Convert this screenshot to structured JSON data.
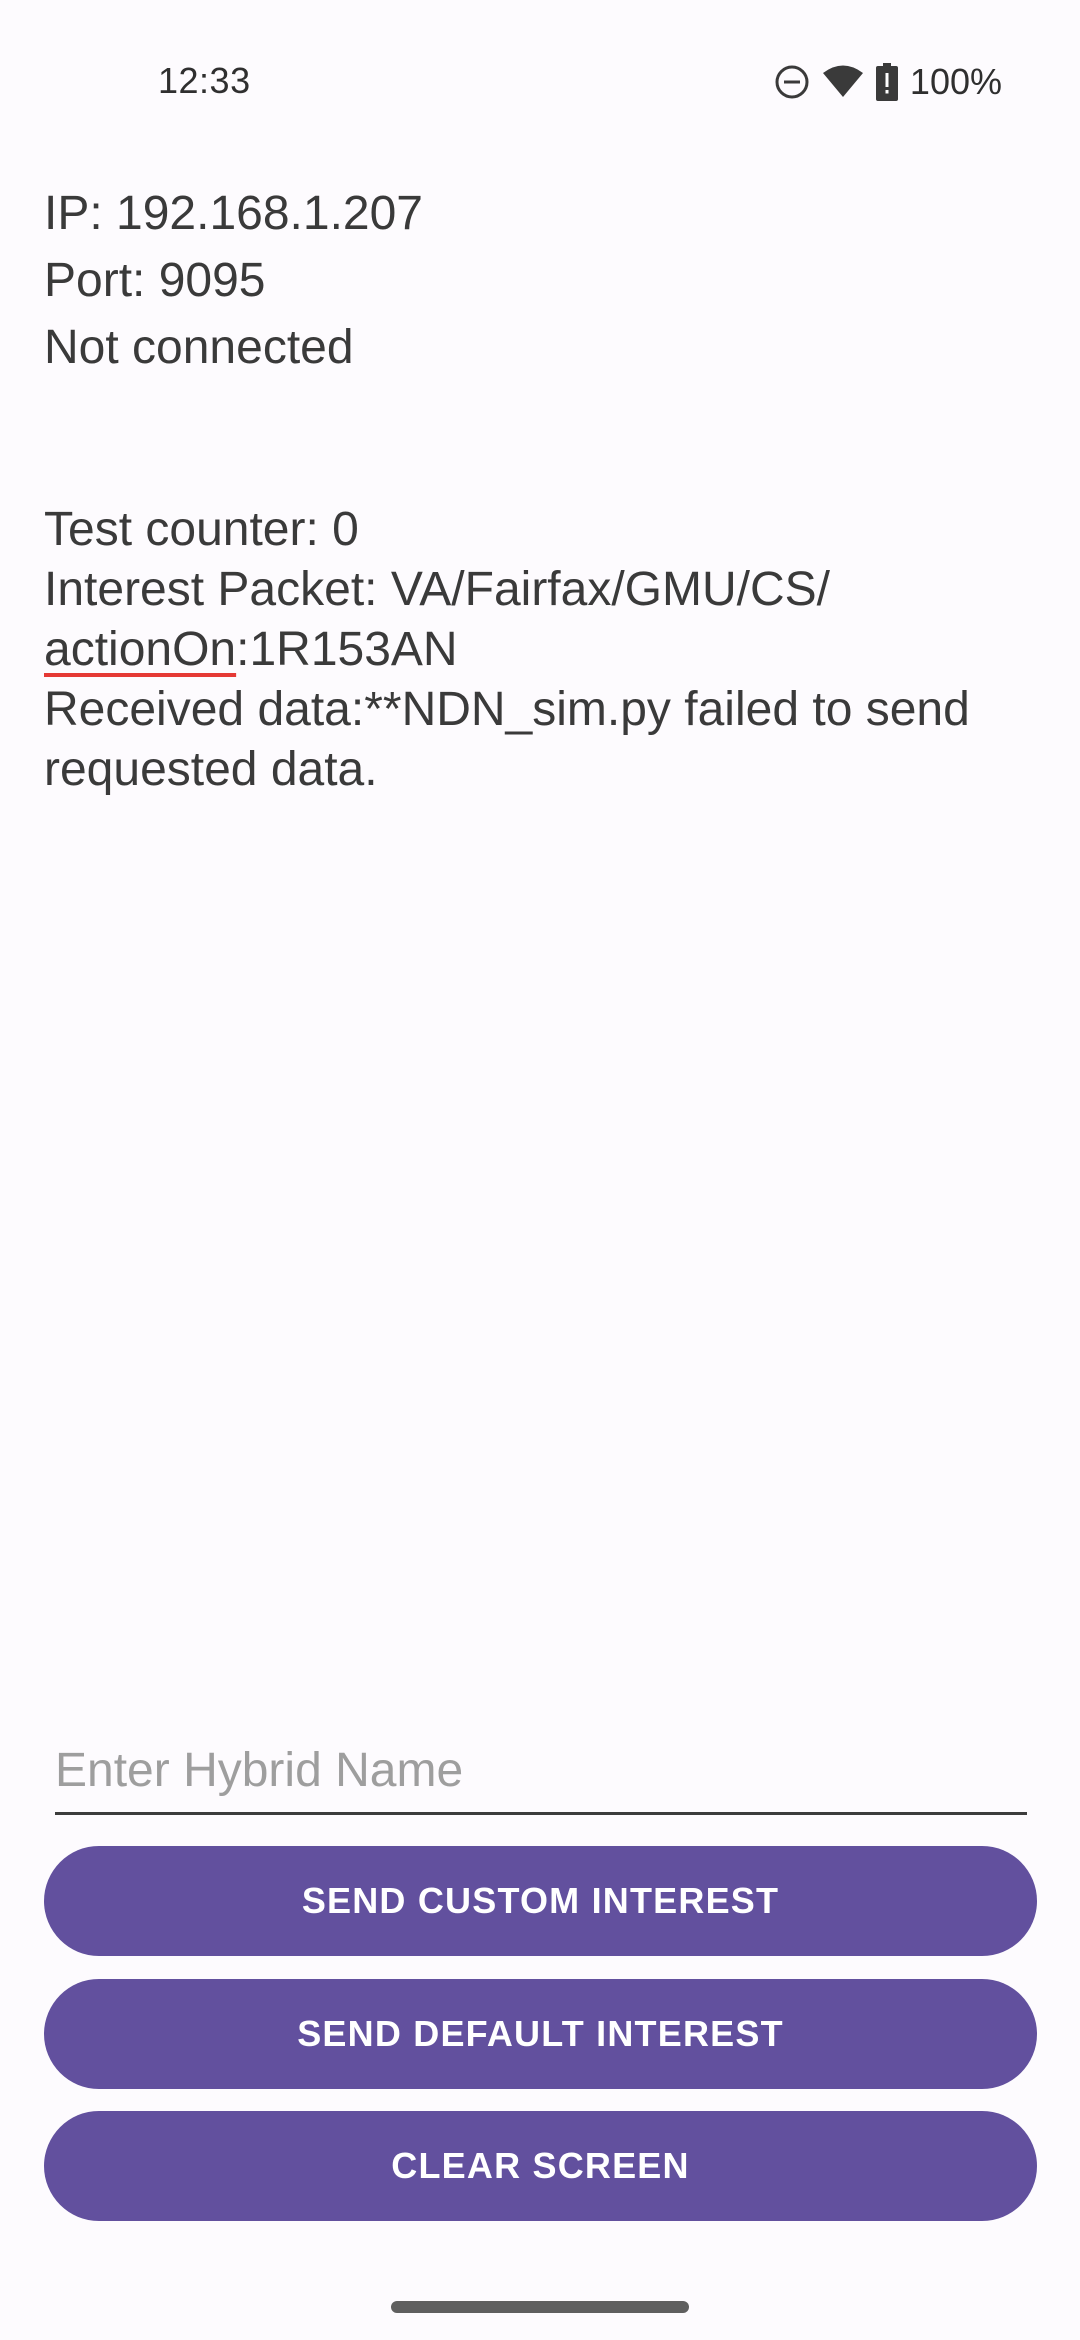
{
  "status_bar": {
    "time": "12:33",
    "battery": "100%",
    "icons": [
      "do-not-disturb-icon",
      "wifi-icon",
      "battery-alert-icon"
    ]
  },
  "connection": {
    "ip": "IP: 192.168.1.207",
    "port": "Port: 9095",
    "status": "Not connected"
  },
  "log": {
    "counter": "Test counter: 0",
    "interest_line1": "Interest Packet: VA/Fairfax/GMU/CS/",
    "interest_word": "actionOn",
    "interest_suffix": ":1R153AN",
    "received": "Received data:**NDN_sim.py failed to send requested data."
  },
  "input": {
    "placeholder": "Enter Hybrid Name",
    "value": ""
  },
  "buttons": {
    "send_custom": "SEND CUSTOM INTEREST",
    "send_default": "SEND DEFAULT INTEREST",
    "clear": "CLEAR SCREEN"
  },
  "colors": {
    "background": "#FDFBFE",
    "button": "#62509E",
    "button_text": "#FFFFFF",
    "text": "#3A3A3A",
    "spellcheck_underline": "#E53935"
  }
}
